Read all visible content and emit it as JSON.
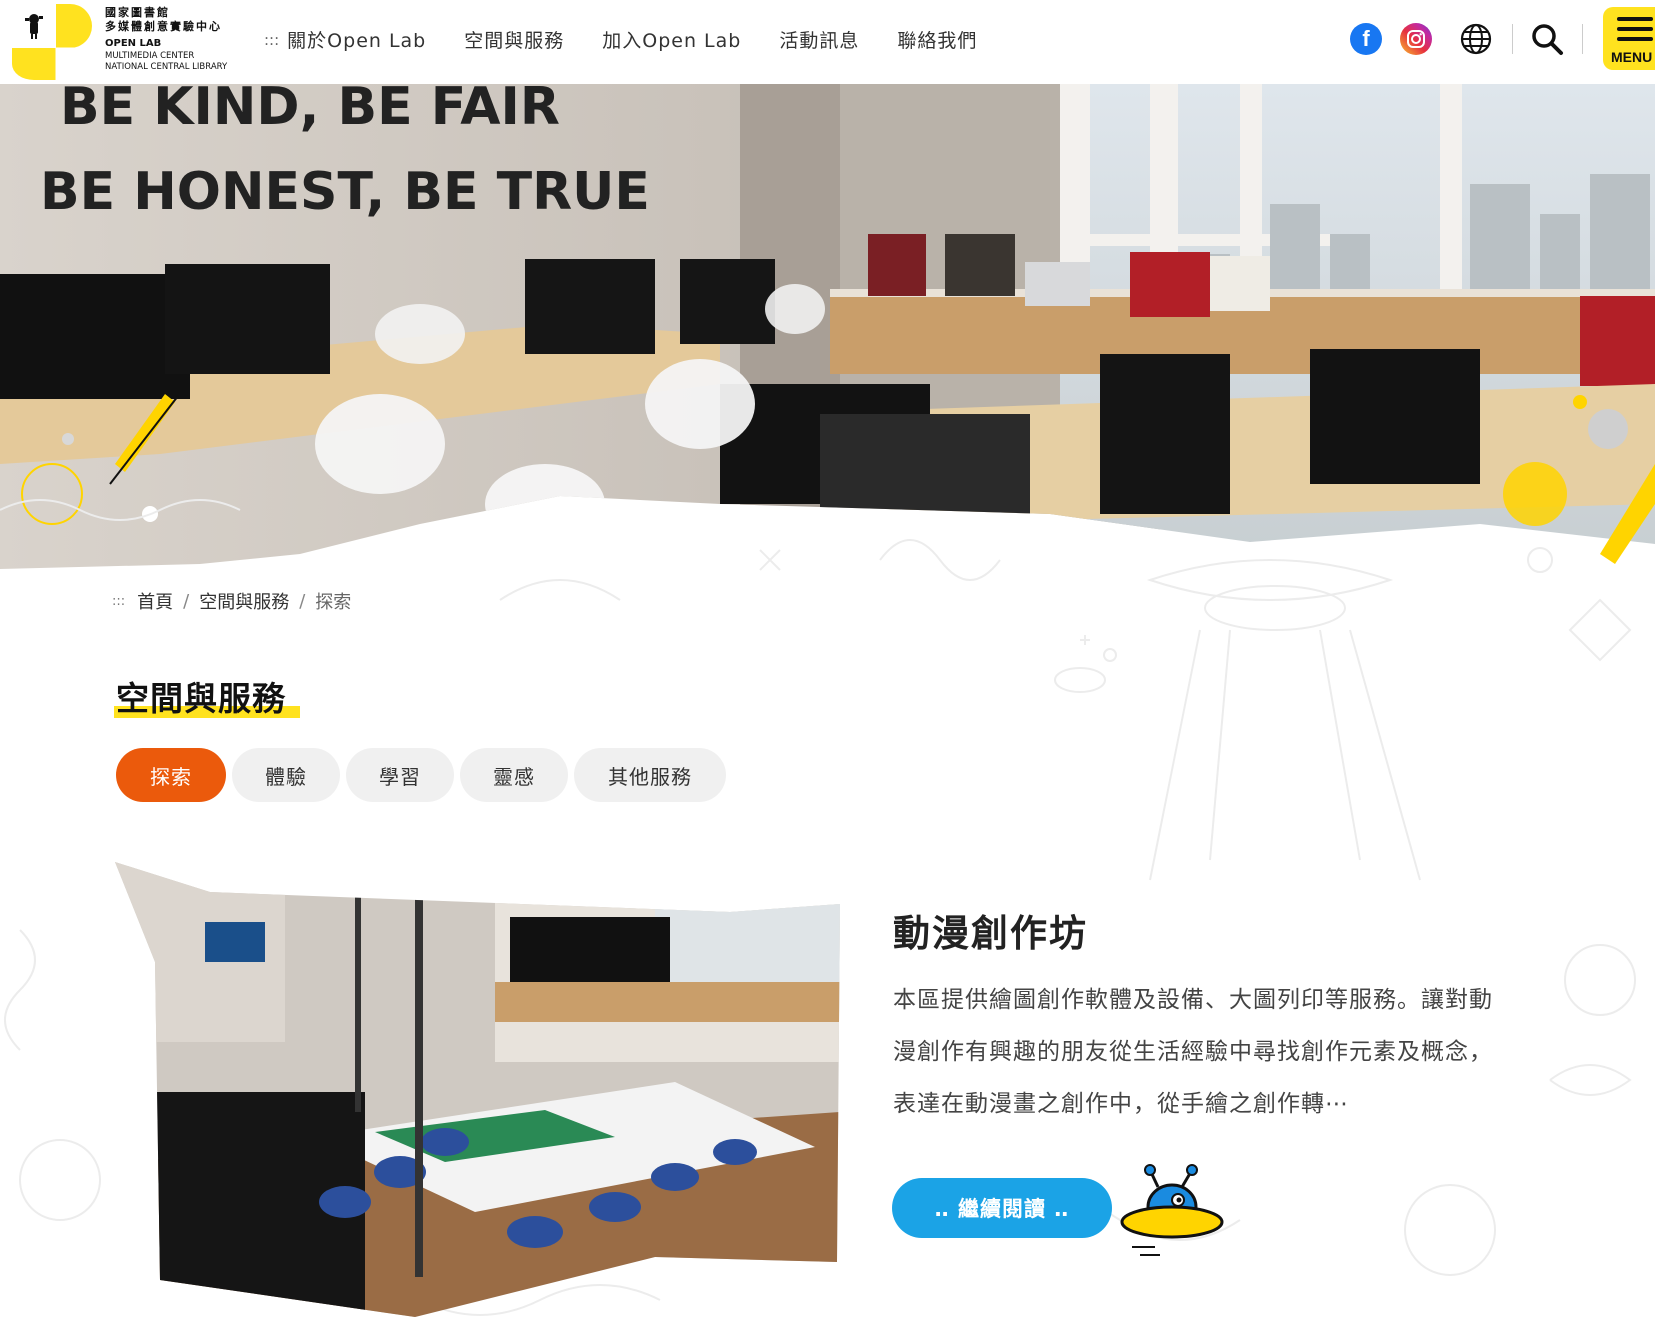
{
  "header": {
    "logo": {
      "line1": "國家圖書館",
      "line2": "多媒體創意實驗中心",
      "line3": "OPEN LAB",
      "line4": "MULTIMEDIA CENTER",
      "line5": "NATIONAL CENTRAL LIBRARY"
    },
    "nav_prefix": ":::",
    "nav": [
      {
        "label": "關於Open Lab"
      },
      {
        "label": "空間與服務"
      },
      {
        "label": "加入Open Lab"
      },
      {
        "label": "活動訊息"
      },
      {
        "label": "聯絡我們"
      }
    ],
    "menu_label": "MENU",
    "icons": [
      "facebook-icon",
      "instagram-icon",
      "globe-icon",
      "search-icon",
      "menu-icon"
    ],
    "facebook_glyph": "f"
  },
  "hero": {
    "wall_text_line1": "BE KIND, BE FAIR",
    "wall_text_line2": "BE HONEST, BE TRUE"
  },
  "breadcrumb": {
    "prefix": ":::",
    "items": [
      "首頁",
      "空間與服務",
      "探索"
    ],
    "separator": "/"
  },
  "page_title": "空間與服務",
  "tabs": [
    {
      "label": "探索",
      "active": true
    },
    {
      "label": "體驗",
      "active": false
    },
    {
      "label": "學習",
      "active": false
    },
    {
      "label": "靈感",
      "active": false
    },
    {
      "label": "其他服務",
      "active": false
    }
  ],
  "card": {
    "title": "動漫創作坊",
    "description": "本區提供繪圖創作軟體及設備、大圖列印等服務。讓對動漫創作有興趣的朋友從生活經驗中尋找創作元素及概念，表達在動漫畫之創作中，從手繪之創作轉⋯",
    "read_more": "‥ 繼續閱讀 ‥"
  },
  "colors": {
    "accent_yellow": "#ffe21f",
    "active_tab": "#eb5a0c",
    "button_blue": "#1ba3e6",
    "facebook": "#1877f2"
  }
}
